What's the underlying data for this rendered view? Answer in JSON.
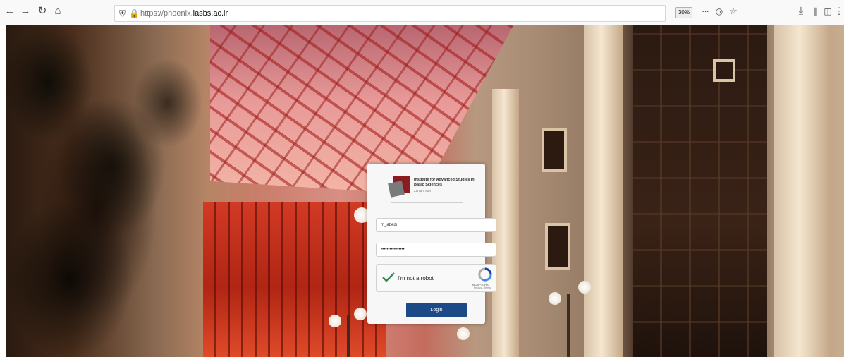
{
  "browser": {
    "url_scheme": "https://",
    "url_subdomain": "phoenix.",
    "url_domain": "iasbs.ac.ir",
    "zoom": "30%",
    "page_actions_label": "···"
  },
  "login": {
    "institute_title": "Institute for Advanced Studies in Basic Sciences",
    "institute_subtitle": "Zanjan, Iran",
    "username_value": "m_abedi",
    "password_value": "••••••••••••••••",
    "captcha_label": "I'm not a robot",
    "recaptcha_brand": "reCAPTCHA",
    "recaptcha_links": "Privacy - Terms",
    "login_button_label": "Login"
  },
  "colors": {
    "accent": "#1d4a87",
    "brand_red": "#8a1d22",
    "checkmark": "#2e8b57"
  },
  "icons": [
    "back-icon",
    "forward-icon",
    "reload-icon",
    "home-icon",
    "shield-icon",
    "lock-icon",
    "more-icon",
    "pocket-icon",
    "bookmark-icon",
    "download-icon",
    "library-icon",
    "sidebar-icon",
    "menu-icon",
    "recaptcha-icon",
    "checkmark-icon"
  ]
}
